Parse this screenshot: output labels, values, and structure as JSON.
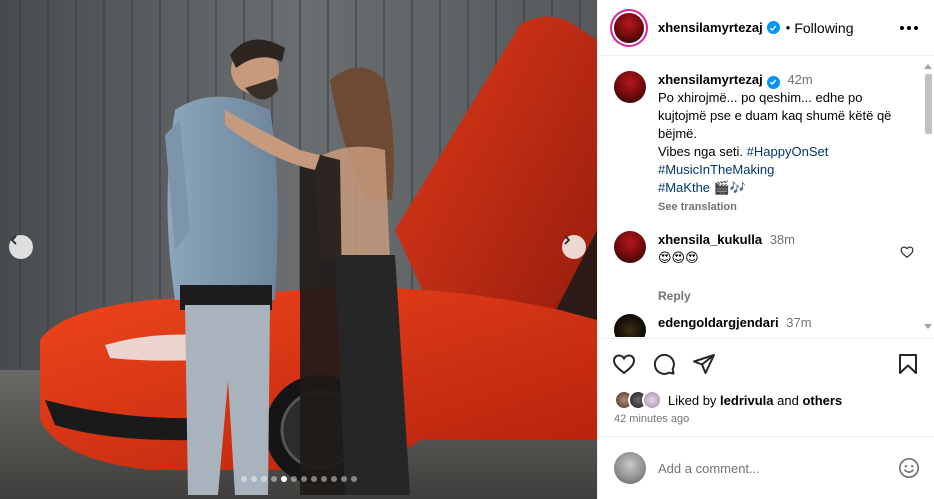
{
  "post": {
    "author": "xhensilamyrtezaj",
    "follow_status": "Following",
    "separator": "•",
    "media_slide_count": 12,
    "media_active_slide": 4
  },
  "caption": {
    "username": "xhensilamyrtezaj",
    "time": "42m",
    "line1": "Po xhirojmë... po qeshim... edhe po kujtojmë pse e duam kaq shumë këtë që bëjmë.",
    "line2": "Vibes nga seti.",
    "hashtags": [
      "#HappyOnSet",
      "#MusicInTheMaking",
      "#MaKthe"
    ],
    "emoji": "🎬🎶",
    "see_translation": "See translation"
  },
  "comments": [
    {
      "username": "xhensila_kukulla",
      "time": "38m",
      "text": "😍😍😍",
      "reply": "Reply"
    },
    {
      "username": "edengoldargjendari",
      "time": "37m",
      "text": ""
    }
  ],
  "likes": {
    "prefix": "Liked by",
    "user": "ledrivula",
    "conjunction": "and",
    "others": "others"
  },
  "timestamp": "42 minutes ago",
  "add_comment": {
    "placeholder": "Add a comment..."
  },
  "icons": {
    "like": "heart-icon",
    "comment": "comment-icon",
    "share": "share-icon",
    "save": "bookmark-icon",
    "more": "more-icon",
    "emoji": "emoji-icon"
  }
}
